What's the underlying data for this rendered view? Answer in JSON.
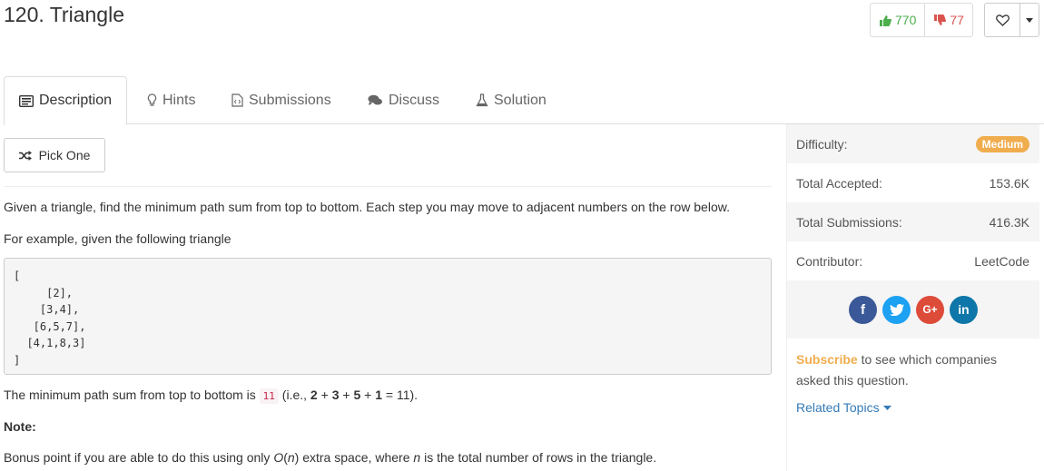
{
  "problem": {
    "title": "120. Triangle"
  },
  "votes": {
    "up": "770",
    "down": "77"
  },
  "colors": {
    "up": "#4cae4c",
    "down": "#d9534f",
    "badge": "#f0ad4e",
    "link": "#337ab7",
    "facebook": "#3b5998",
    "twitter": "#1da1f2",
    "google": "#dd4b39",
    "linkedin": "#0e76a8"
  },
  "tabs": [
    {
      "label": "Description",
      "icon": "description-icon"
    },
    {
      "label": "Hints",
      "icon": "lightbulb-icon"
    },
    {
      "label": "Submissions",
      "icon": "code-file-icon"
    },
    {
      "label": "Discuss",
      "icon": "chat-bubbles-icon"
    },
    {
      "label": "Solution",
      "icon": "flask-icon"
    }
  ],
  "pick_one": {
    "label": "Pick One"
  },
  "description": {
    "p1": "Given a triangle, find the minimum path sum from top to bottom. Each step you may move to adjacent numbers on the row below.",
    "p2": "For example, given the following triangle",
    "code": "[\n     [2],\n    [3,4],\n   [6,5,7],\n  [4,1,8,3]\n]",
    "p3_prefix": "The minimum path sum from top to bottom is ",
    "p3_code": "11",
    "p3_mid": " (i.e., ",
    "p3_n1": "2",
    "p3_plus1": " + ",
    "p3_n2": "3",
    "p3_plus2": " + ",
    "p3_n3": "5",
    "p3_plus3": " + ",
    "p3_n4": "1",
    "p3_suffix": " = 11).",
    "note": "Note:",
    "p4_a": "Bonus point if you are able to do this using only ",
    "p4_on": "O",
    "p4_b": "(",
    "p4_n": "n",
    "p4_c": ") extra space, where ",
    "p4_n2": "n",
    "p4_d": " is the total number of rows in the triangle."
  },
  "sidebar": {
    "difficulty_label": "Difficulty:",
    "difficulty_value": "Medium",
    "accepted_label": "Total Accepted:",
    "accepted_value": "153.6K",
    "submissions_label": "Total Submissions:",
    "submissions_value": "416.3K",
    "contributor_label": "Contributor:",
    "contributor_value": "LeetCode",
    "social": {
      "facebook": "f",
      "twitter": "t",
      "google": "G+",
      "linkedin": "in"
    },
    "subscribe_link": "Subscribe",
    "subscribe_text": " to see which companies asked this question.",
    "related_topics": "Related Topics"
  }
}
